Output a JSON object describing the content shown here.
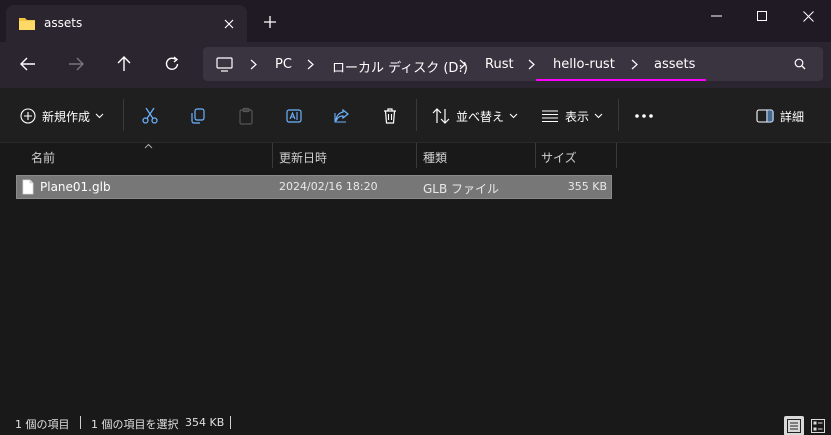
{
  "window": {
    "tab_title": "assets"
  },
  "nav": {
    "breadcrumbs": [
      "PC",
      "ローカル ディスク (D:)",
      "Rust",
      "hello-rust",
      "assets"
    ]
  },
  "commands": {
    "new_label": "新規作成",
    "sort_label": "並べ替え",
    "view_label": "表示",
    "details_label": "詳細"
  },
  "columns": {
    "name": "名前",
    "modified": "更新日時",
    "type": "種類",
    "size": "サイズ"
  },
  "files": [
    {
      "name": "Plane01.glb",
      "modified": "2024/02/16 18:20",
      "type": "GLB ファイル",
      "size": "355 KB"
    }
  ],
  "status": {
    "item_count": "1 個の項目",
    "selection": "1 個の項目を選択",
    "selection_size": "354 KB"
  },
  "colors": {
    "accent_underline": "#ff00ff",
    "selected_row": "#777777"
  }
}
